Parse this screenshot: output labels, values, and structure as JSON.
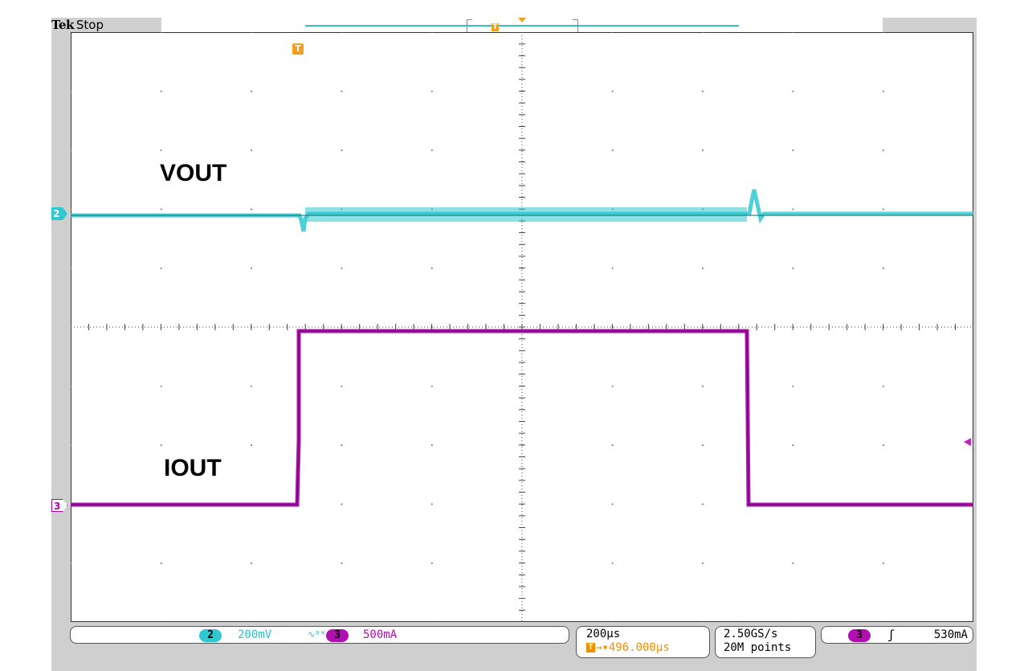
{
  "header": {
    "brand": "Tek",
    "state": "Stop",
    "trigger_position_glyph": "T"
  },
  "screen": {
    "trigger_marker_glyph": "T",
    "ch2_marker_glyph": "2",
    "ch3_marker_glyph": "3",
    "labels": {
      "vout": "VOUT",
      "iout": "IOUT"
    },
    "colors": {
      "ch2": "#30c8d0",
      "ch3": "#b010b0",
      "trigger": "#f0a020"
    }
  },
  "readout": {
    "ch2": {
      "num": "2",
      "scale": "200mV",
      "bw_icon": "∿ᴮᵂ"
    },
    "ch3": {
      "num": "3",
      "scale": "500mA"
    },
    "horizontal": {
      "timebase": "200µs",
      "delay_marker": "T",
      "delay": "→▾496.000µs"
    },
    "acquisition": {
      "sample_rate": "2.50GS/s",
      "record_length": "20M points"
    },
    "trigger": {
      "source": "3",
      "slope_icon": "ʃ",
      "level": "530mA"
    }
  }
}
